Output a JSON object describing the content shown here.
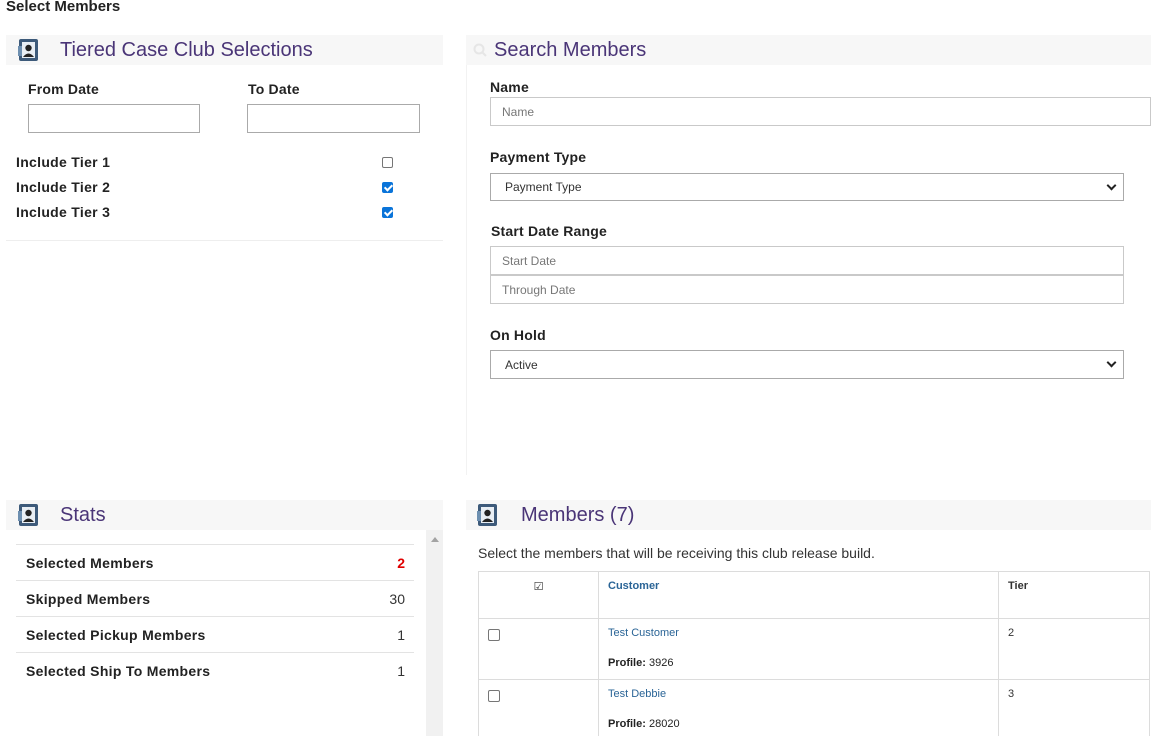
{
  "page_title": "Select Members",
  "tiered": {
    "title": "Tiered Case Club Selections",
    "from_label": "From Date",
    "to_label": "To Date",
    "from_value": "",
    "to_value": "",
    "tiers": [
      {
        "label": "Include Tier 1",
        "checked": false
      },
      {
        "label": "Include Tier 2",
        "checked": true
      },
      {
        "label": "Include Tier 3",
        "checked": true
      }
    ]
  },
  "search": {
    "title": "Search Members",
    "name_label": "Name",
    "name_placeholder": "Name",
    "payment_label": "Payment Type",
    "payment_value": "Payment Type",
    "date_range_label": "Start Date Range",
    "start_placeholder": "Start Date",
    "through_placeholder": "Through Date",
    "hold_label": "On Hold",
    "hold_value": "Active"
  },
  "stats": {
    "title": "Stats",
    "rows": [
      {
        "label": "Selected Members",
        "value": "2",
        "highlight": true
      },
      {
        "label": "Skipped Members",
        "value": "30",
        "highlight": false
      },
      {
        "label": "Selected Pickup Members",
        "value": "1",
        "highlight": false
      },
      {
        "label": "Selected Ship To Members",
        "value": "1",
        "highlight": false
      }
    ]
  },
  "members": {
    "title": "Members (7)",
    "description": "Select the members that will be receiving this club release build.",
    "header_check": "☑",
    "col_customer": "Customer",
    "col_tier": "Tier",
    "rows": [
      {
        "name": "Test Customer",
        "profile_label": "Profile:",
        "profile": "3926",
        "tier": "2",
        "checked": false
      },
      {
        "name": "Test Debbie",
        "profile_label": "Profile:",
        "profile": "28020",
        "tier": "3",
        "checked": false
      }
    ]
  },
  "colors": {
    "accent_title": "#4a3577",
    "link": "#2a6496",
    "highlight_red": "#e00000",
    "checkbox_blue": "#0a74d9"
  }
}
